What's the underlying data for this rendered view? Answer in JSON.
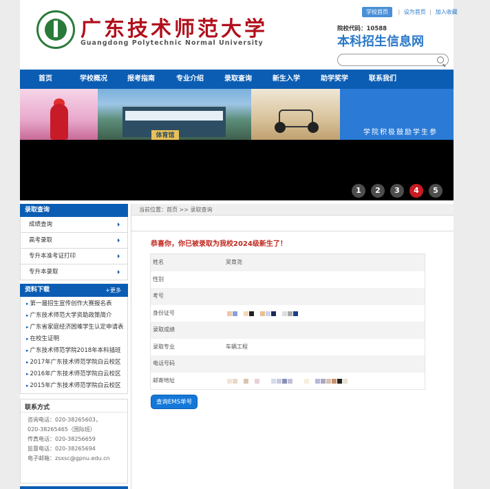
{
  "header": {
    "logo_cn": "广东技术师范大学",
    "logo_en": "Guangdong Polytechnic Normal University",
    "home_button": "学校首页",
    "set_home": "设为首页",
    "favorite": "加入收藏",
    "school_code": "院校代码：10588",
    "site_name": "本科招生信息网",
    "search_placeholder": ""
  },
  "nav": {
    "items": [
      "首页",
      "学校概况",
      "报考指南",
      "专业介绍",
      "录取查询",
      "新生入学",
      "助学奖学",
      "联系我们"
    ]
  },
  "banner": {
    "photo2_sign": "体育馆",
    "photo4_text": "学院积极鼓励学生参",
    "pages": [
      "1",
      "2",
      "3",
      "4",
      "5"
    ],
    "active_page": "4"
  },
  "sidebar": {
    "title": "录取查询",
    "items": [
      "成绩查询",
      "高考录取",
      "专升本准考证打印",
      "专升本录取"
    ]
  },
  "downloads": {
    "title": "资料下载",
    "more": "+更多",
    "items": [
      "第一届招生宣传创作大赛报名表",
      "广东技术师范大学资助政策简介",
      "广东省家庭经济困难学生认定申请表",
      "在校生证明",
      "广东技术师范学院2018年本科插班",
      "2017年广东技术师范学院白云校区",
      "2016年广东技术师范学院白云校区",
      "2015年广东技术师范学院白云校区"
    ]
  },
  "contact": {
    "title": "联系方式",
    "lines": [
      "咨询电话：020-38265603，",
      "020-38265465（国际班）",
      "传真电话：020-38256659",
      "监督电话：020-38265694",
      "电子邮箱：zsxsc@gpnu.edu.cn"
    ]
  },
  "main": {
    "breadcrumb": "当前位置：首页 >> 录取查询",
    "congrats": "恭喜你，你已被录取为我校2024级新生了！",
    "rows": [
      {
        "label": "姓名",
        "value": "吴育尧"
      },
      {
        "label": "性别",
        "value": ""
      },
      {
        "label": "考号",
        "value": ""
      },
      {
        "label": "身份证号",
        "value": ""
      },
      {
        "label": "录取成绩",
        "value": ""
      },
      {
        "label": "录取专业",
        "value": "车辆工程"
      },
      {
        "label": "电话号码",
        "value": ""
      },
      {
        "label": "邮寄地址",
        "value": ""
      }
    ],
    "express_button": "查询EMS单号"
  },
  "colors": {
    "nav_blue": "#0b5db3",
    "accent_red": "#c81b22",
    "congrats_red": "#c0281e",
    "link_blue": "#2a78c8"
  }
}
